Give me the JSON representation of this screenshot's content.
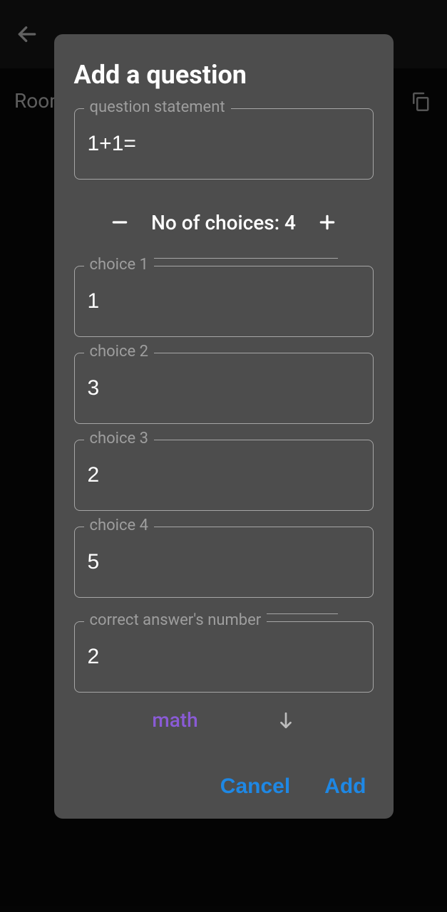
{
  "background": {
    "room_label": "Room"
  },
  "dialog": {
    "title": "Add a question",
    "question_statement_label": "question statement",
    "question_statement_value": "1+1=",
    "num_choices_label_prefix": "No of choices: ",
    "num_choices_value": "4",
    "choices": [
      {
        "label": "choice 1",
        "value": "1"
      },
      {
        "label": "choice 2",
        "value": "3"
      },
      {
        "label": "choice 3",
        "value": "2"
      },
      {
        "label": "choice 4",
        "value": "5"
      }
    ],
    "correct_answer_label": "correct answer's number",
    "correct_answer_value": "2",
    "category_label": "math",
    "cancel_label": "Cancel",
    "add_label": "Add"
  }
}
